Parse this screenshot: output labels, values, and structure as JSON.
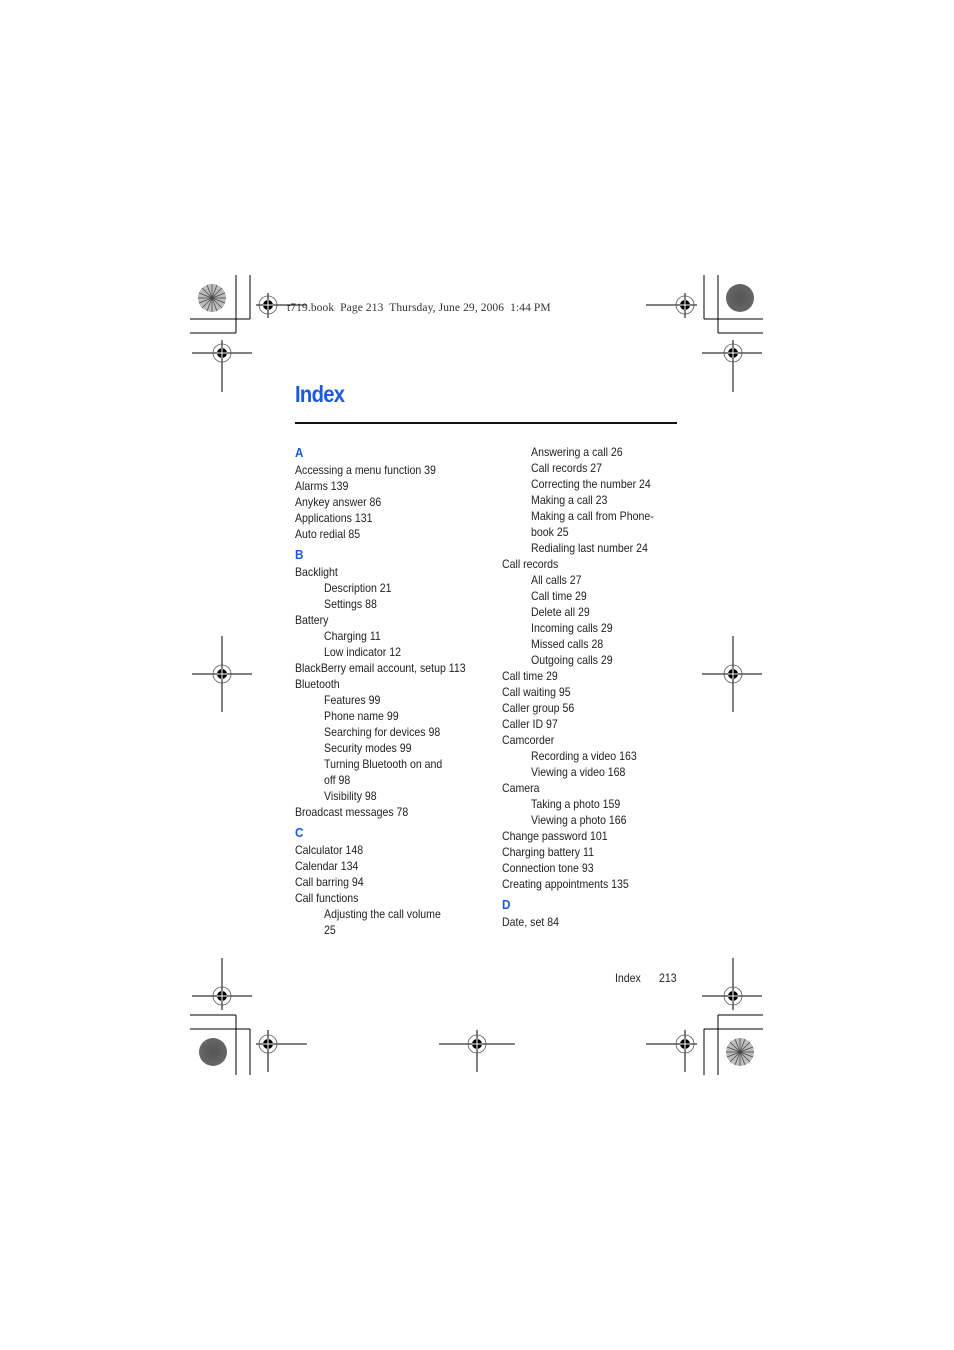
{
  "header": {
    "print_slug": "t719.book  Page 213  Thursday, June 29, 2006  1:44 PM"
  },
  "page_title": "Index",
  "colors": {
    "heading_blue": "#1a5ae0",
    "text": "#222222"
  },
  "columns": {
    "left": [
      {
        "type": "letter",
        "text": "A"
      },
      {
        "type": "entry",
        "text": "Accessing a menu function  39"
      },
      {
        "type": "entry",
        "text": "Alarms  139"
      },
      {
        "type": "entry",
        "text": "Anykey answer  86"
      },
      {
        "type": "entry",
        "text": "Applications  131"
      },
      {
        "type": "entry",
        "text": "Auto redial  85"
      },
      {
        "type": "letter",
        "text": "B"
      },
      {
        "type": "entry",
        "text": "Backlight"
      },
      {
        "type": "sub",
        "text": "Description  21"
      },
      {
        "type": "sub",
        "text": "Settings  88"
      },
      {
        "type": "entry",
        "text": "Battery"
      },
      {
        "type": "sub",
        "text": "Charging  11"
      },
      {
        "type": "sub",
        "text": "Low indicator  12"
      },
      {
        "type": "entry",
        "text": "BlackBerry email account, setup  113"
      },
      {
        "type": "entry",
        "text": "Bluetooth"
      },
      {
        "type": "sub",
        "text": "Features  99"
      },
      {
        "type": "sub",
        "text": "Phone name  99"
      },
      {
        "type": "sub",
        "text": "Searching for devices  98"
      },
      {
        "type": "sub",
        "text": "Security modes  99"
      },
      {
        "type": "sub",
        "text": "Turning Bluetooth on and"
      },
      {
        "type": "sub",
        "text": "off  98"
      },
      {
        "type": "sub",
        "text": "Visibility  98"
      },
      {
        "type": "entry",
        "text": "Broadcast messages  78"
      },
      {
        "type": "letter",
        "text": "C"
      },
      {
        "type": "entry",
        "text": "Calculator  148"
      },
      {
        "type": "entry",
        "text": "Calendar  134"
      },
      {
        "type": "entry",
        "text": "Call barring  94"
      },
      {
        "type": "entry",
        "text": "Call functions"
      },
      {
        "type": "sub",
        "text": "Adjusting the call volume"
      },
      {
        "type": "sub",
        "text": "25"
      }
    ],
    "right": [
      {
        "type": "sub",
        "text": "Answering a call  26"
      },
      {
        "type": "sub",
        "text": "Call records  27"
      },
      {
        "type": "sub",
        "text": "Correcting the number  24"
      },
      {
        "type": "sub",
        "text": "Making a call  23"
      },
      {
        "type": "sub",
        "text": "Making a call from Phone-"
      },
      {
        "type": "sub",
        "text": "book  25"
      },
      {
        "type": "sub",
        "text": "Redialing last number  24"
      },
      {
        "type": "entry",
        "text": "Call records"
      },
      {
        "type": "sub",
        "text": "All calls  27"
      },
      {
        "type": "sub",
        "text": "Call time  29"
      },
      {
        "type": "sub",
        "text": "Delete all  29"
      },
      {
        "type": "sub",
        "text": "Incoming calls  29"
      },
      {
        "type": "sub",
        "text": "Missed calls  28"
      },
      {
        "type": "sub",
        "text": "Outgoing calls  29"
      },
      {
        "type": "entry",
        "text": "Call time  29"
      },
      {
        "type": "entry",
        "text": "Call waiting  95"
      },
      {
        "type": "entry",
        "text": "Caller group  56"
      },
      {
        "type": "entry",
        "text": "Caller ID  97"
      },
      {
        "type": "entry",
        "text": "Camcorder"
      },
      {
        "type": "sub",
        "text": "Recording a video  163"
      },
      {
        "type": "sub",
        "text": "Viewing a video  168"
      },
      {
        "type": "entry",
        "text": "Camera"
      },
      {
        "type": "sub",
        "text": "Taking a photo  159"
      },
      {
        "type": "sub",
        "text": "Viewing a photo  166"
      },
      {
        "type": "entry",
        "text": "Change password  101"
      },
      {
        "type": "entry",
        "text": "Charging battery  11"
      },
      {
        "type": "entry",
        "text": "Connection tone  93"
      },
      {
        "type": "entry",
        "text": "Creating appointments  135"
      },
      {
        "type": "letter",
        "text": "D"
      },
      {
        "type": "entry",
        "text": "Date, set  84"
      }
    ]
  },
  "footer": {
    "section_label": "Index",
    "page_number": "213"
  },
  "icons": {
    "registration_mark": "crosshair-circle-icon",
    "color_target": "starburst-target-icon",
    "density_patch": "gray-dot-icon"
  }
}
